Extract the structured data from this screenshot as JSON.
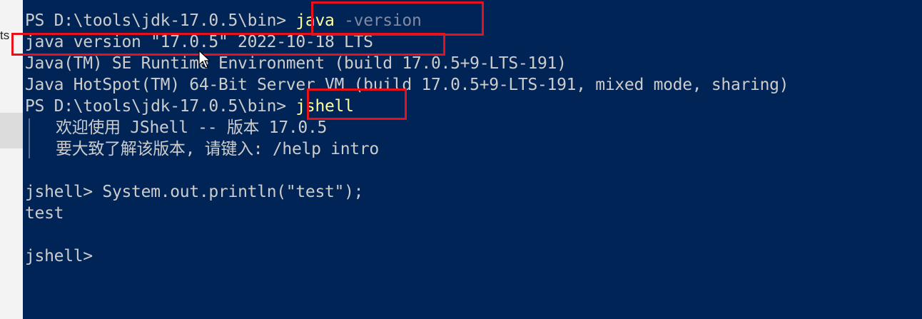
{
  "sidebar": {
    "fragment_text": "ts"
  },
  "terminal": {
    "lines": [
      {
        "prompt": "PS D:\\tools\\jdk-17.0.5\\bin>",
        "command": "java",
        "parameter": "-version"
      },
      {
        "text": "java version \"17.0.5\" 2022-10-18 LTS"
      },
      {
        "text": "Java(TM) SE Runtime Environment (build 17.0.5+9-LTS-191)"
      },
      {
        "text": "Java HotSpot(TM) 64-Bit Server VM (build 17.0.5+9-LTS-191, mixed mode, sharing)"
      },
      {
        "prompt": "PS D:\\tools\\jdk-17.0.5\\bin>",
        "command": "jshell"
      },
      {
        "text": "欢迎使用 JShell -- 版本 17.0.5"
      },
      {
        "text": "要大致了解该版本, 请键入: /help intro"
      },
      {
        "text": ""
      },
      {
        "prompt": "jshell>",
        "command": "System.out.println(\"test\");"
      },
      {
        "text": "test"
      },
      {
        "text": ""
      },
      {
        "prompt": "jshell>"
      }
    ]
  },
  "colors": {
    "background": "#012456",
    "text": "#cccccc",
    "command": "#ffff9e",
    "parameter": "#7f8aa0",
    "annotation": "#e8101a"
  },
  "icons": {
    "cursor": "mouse-pointer-icon"
  }
}
